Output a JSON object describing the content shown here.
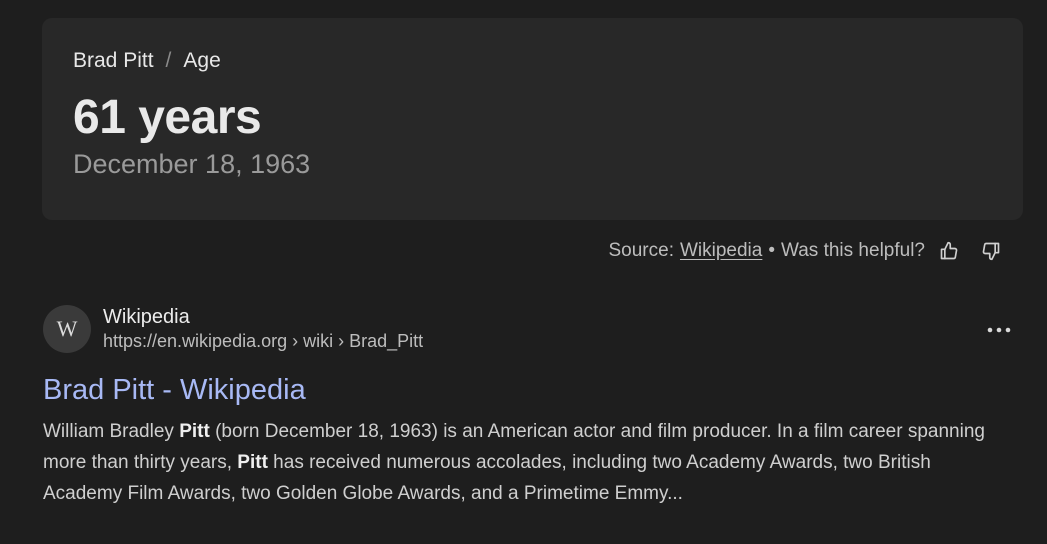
{
  "answer": {
    "breadcrumb": [
      "Brad Pitt",
      "Age"
    ],
    "separator": "/",
    "value": "61 years",
    "detail": "December 18, 1963"
  },
  "feedback": {
    "source_label": "Source:",
    "source_link": "Wikipedia",
    "separator": "•",
    "question": "Was this helpful?",
    "icons": [
      "thumbs-up-icon",
      "thumbs-down-icon"
    ]
  },
  "result": {
    "logo_letter": "W",
    "site_name": "Wikipedia",
    "url": "https://en.wikipedia.org › wiki › Brad_Pitt",
    "title": "Brad Pitt - Wikipedia",
    "more_icon": "more-horizontal-icon",
    "snippet_parts": [
      {
        "text": "William Bradley ",
        "bold": false
      },
      {
        "text": "Pitt",
        "bold": true
      },
      {
        "text": " (born December 18, 1963) is an American actor and film producer. In a film career spanning more than thirty years, ",
        "bold": false
      },
      {
        "text": "Pitt",
        "bold": true
      },
      {
        "text": " has received numerous accolades, including two Academy Awards, two British Academy Film Awards, two Golden Globe Awards, and a Primetime Emmy...",
        "bold": false
      }
    ]
  },
  "colors": {
    "background": "#1e1e1e",
    "card": "#282828",
    "link": "#a8b9f5"
  }
}
